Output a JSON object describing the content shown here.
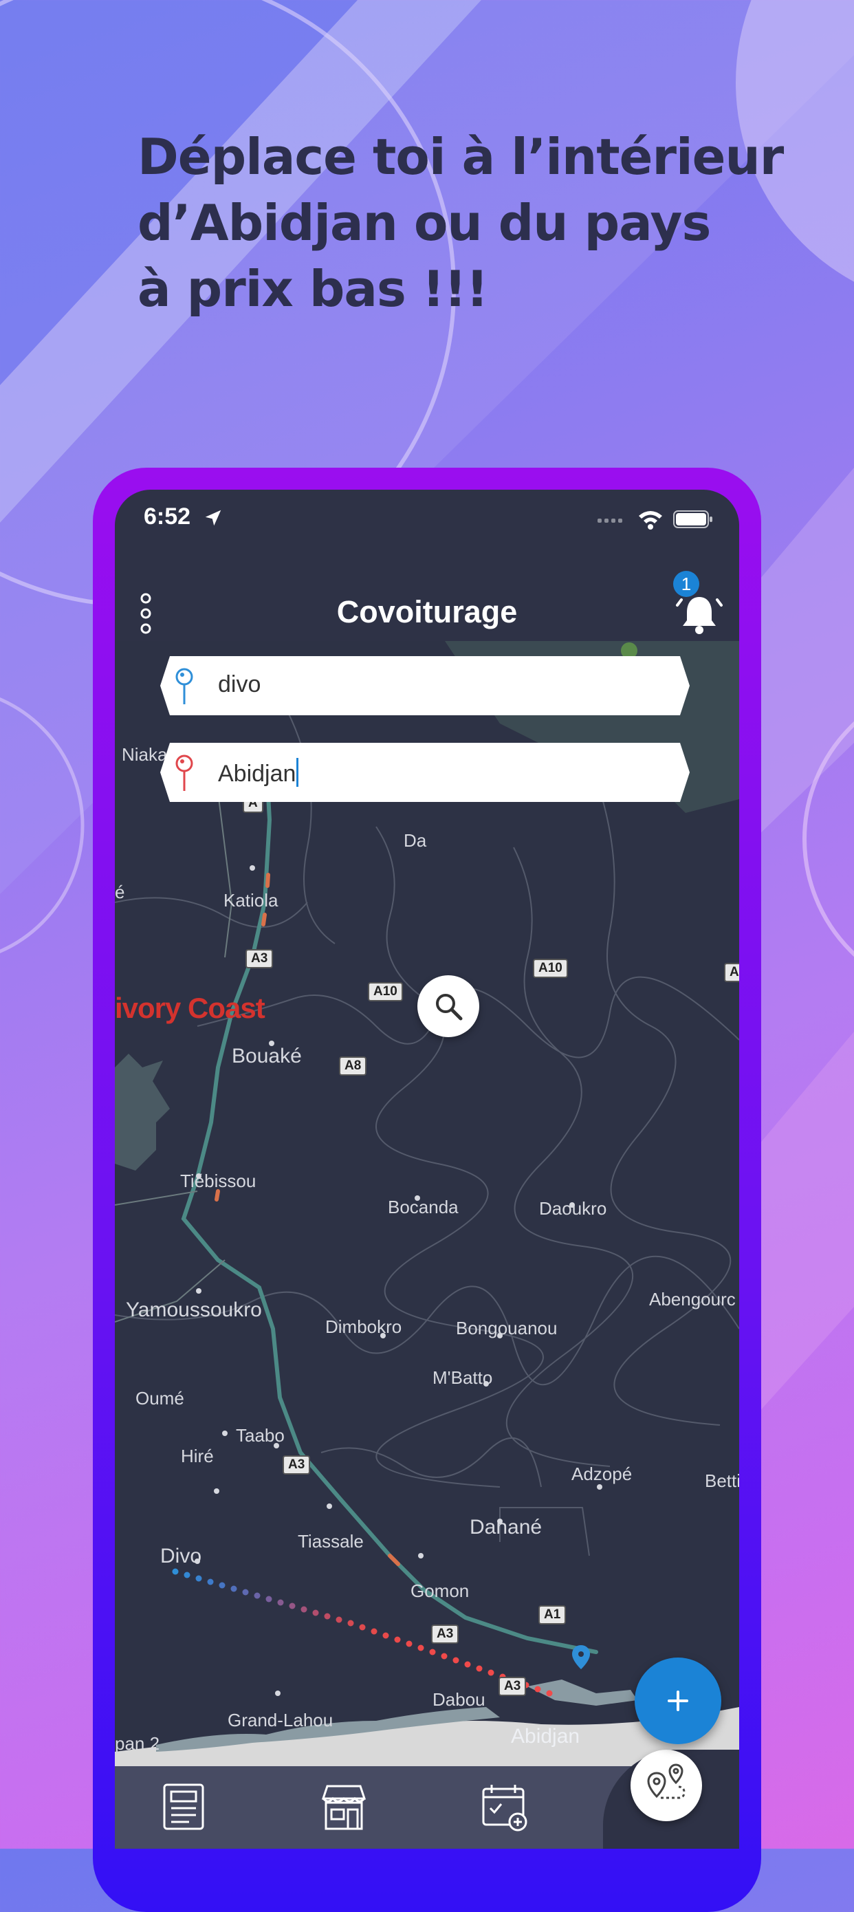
{
  "headline": {
    "line1": "Déplace toi à l’intérieur",
    "line2": "d’Abidjan ou du pays",
    "line3": "à prix bas !!!"
  },
  "status_bar": {
    "time": "6:52",
    "icons": [
      "location-arrow-icon",
      "signal-icon",
      "wifi-icon",
      "battery-icon"
    ]
  },
  "app_bar": {
    "title": "Covoiturage",
    "menu_icon": "more-vertical-icon",
    "notification_icon": "bell-icon",
    "notification_count": "1"
  },
  "search": {
    "origin_value": "divo",
    "destination_value": "Abidjan",
    "origin_pin_color": "#2f8fd8",
    "destination_pin_color": "#e0474c",
    "search_icon": "search-icon"
  },
  "map": {
    "country_label": "ivory Coast",
    "places": {
      "yamoussoukro": "Yamoussoukro",
      "bouake": "Bouaké",
      "katiola": "Katiola",
      "tiebissou": "Tiébissou",
      "bocanda": "Bocanda",
      "daoukro": "Daoukro",
      "abengourou": "Abengourc",
      "dimbokro": "Dimbokro",
      "bongouanou": "Bongouanou",
      "mbatto": "M'Batto",
      "oume": "Oumé",
      "taabo": "Taabo",
      "hire": "Hiré",
      "adzope": "Adzopé",
      "bettie": "Betti",
      "tiassale": "Tiassale",
      "danane": "Danané",
      "divo": "Divo",
      "gomon": "Gomon",
      "dabou": "Dabou",
      "grand_lahou": "Grand-Lahou",
      "abidjan": "Abidjan",
      "niakara": "Niaka",
      "dabakala": "Da",
      "pan2": "pan 2",
      "left_e": "é"
    },
    "road_tags": {
      "a3_top": "A3",
      "a10_left": "A10",
      "a10_right": "A10",
      "a8": "A8",
      "a3_mid": "A3",
      "a1": "A1",
      "a3_low": "A3",
      "a3_bottom": "A3",
      "a_edge": "A",
      "a_top": "A"
    },
    "route_start_color": "#2f8fd8",
    "route_end_color": "#f04a4a"
  },
  "fab": {
    "icon": "plus-icon",
    "color": "#1b83d6"
  },
  "bottom_nav": {
    "items": [
      "newspaper-icon",
      "store-icon",
      "calendar-check-icon",
      "route-map-icon"
    ]
  }
}
